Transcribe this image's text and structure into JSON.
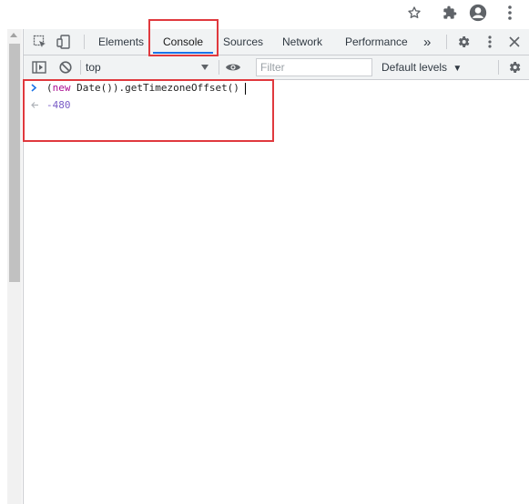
{
  "browser": {
    "icons": [
      "star-icon",
      "extensions-icon",
      "account-icon",
      "menu-icon"
    ]
  },
  "devtools": {
    "tabs": [
      {
        "label": "Elements"
      },
      {
        "label": "Console"
      },
      {
        "label": "Sources"
      },
      {
        "label": "Network"
      },
      {
        "label": "Performance"
      }
    ],
    "more_tabs_symbol": "»",
    "context": "top",
    "filter_placeholder": "Filter",
    "levels_label": "Default levels"
  },
  "console": {
    "input_prefix": "(",
    "input_keyword": "new",
    "input_rest": " Date()).getTimezoneOffset()",
    "result_value": "-480"
  },
  "colors": {
    "highlight": "#e0393e",
    "active_tab_underline": "#1a73e8",
    "keyword": "#aa0d91",
    "result_number": "#7a5dc7"
  }
}
